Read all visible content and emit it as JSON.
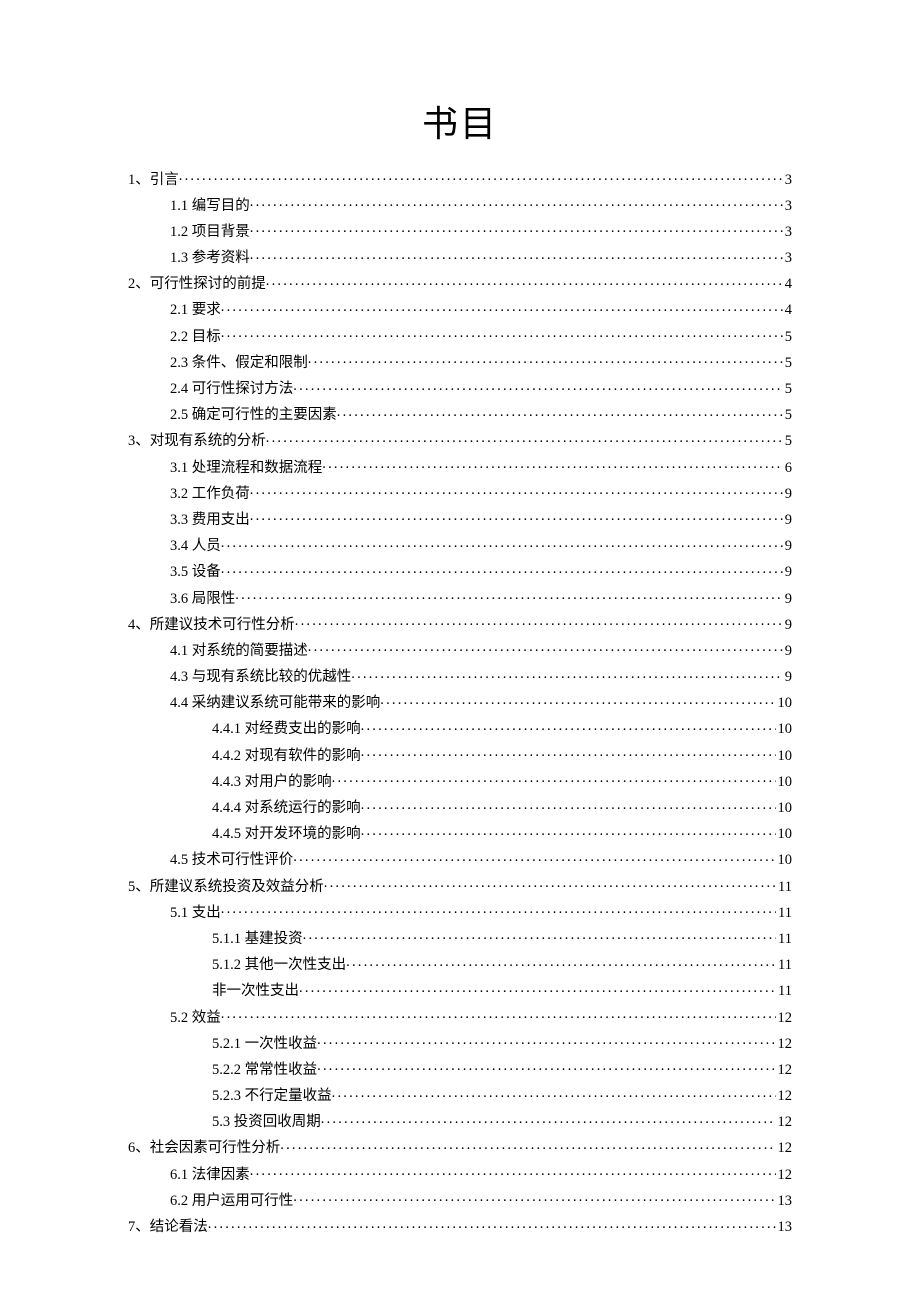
{
  "title": "书目",
  "toc": [
    {
      "level": 1,
      "label": "1、引言",
      "page": "3"
    },
    {
      "level": 2,
      "label": "1.1 编写目的",
      "page": "3"
    },
    {
      "level": 2,
      "label": "1.2 项目背景",
      "page": "3"
    },
    {
      "level": 2,
      "label": "1.3 参考资料",
      "page": "3"
    },
    {
      "level": 1,
      "label": "2、可行性探讨的前提",
      "page": "4"
    },
    {
      "level": 2,
      "label": "2.1 要求",
      "page": "4"
    },
    {
      "level": 2,
      "label": "2.2 目标",
      "page": "5"
    },
    {
      "level": 2,
      "label": "2.3 条件、假定和限制",
      "page": "5"
    },
    {
      "level": 2,
      "label": "2.4 可行性探讨方法",
      "page": "5"
    },
    {
      "level": 2,
      "label": "2.5 确定可行性的主要因素",
      "page": "5"
    },
    {
      "level": 1,
      "label": "3、对现有系统的分析",
      "page": "5"
    },
    {
      "level": 2,
      "label": "3.1 处理流程和数据流程",
      "page": "6"
    },
    {
      "level": 2,
      "label": "3.2 工作负荷",
      "page": "9"
    },
    {
      "level": 2,
      "label": "3.3 费用支出",
      "page": "9"
    },
    {
      "level": 2,
      "label": "3.4 人员",
      "page": "9"
    },
    {
      "level": 2,
      "label": "3.5 设备",
      "page": "9"
    },
    {
      "level": 2,
      "label": "3.6 局限性",
      "page": "9"
    },
    {
      "level": 1,
      "label": "4、所建议技术可行性分析",
      "page": "9"
    },
    {
      "level": 2,
      "label": "4.1 对系统的简要描述",
      "page": "9"
    },
    {
      "level": 2,
      "label": "4.3 与现有系统比较的优越性",
      "page": "9"
    },
    {
      "level": 2,
      "label": "4.4 采纳建议系统可能带来的影响",
      "page": "10"
    },
    {
      "level": 3,
      "label": "4.4.1 对经费支出的影响",
      "page": "10"
    },
    {
      "level": 3,
      "label": "4.4.2 对现有软件的影响",
      "page": "10"
    },
    {
      "level": 3,
      "label": "4.4.3 对用户的影响",
      "page": "10"
    },
    {
      "level": 3,
      "label": "4.4.4 对系统运行的影响",
      "page": "10"
    },
    {
      "level": 3,
      "label": "4.4.5 对开发环境的影响",
      "page": "10"
    },
    {
      "level": 2,
      "label": "4.5 技术可行性评价 ",
      "page": "10"
    },
    {
      "level": 1,
      "label": "5、所建议系统投资及效益分析",
      "page": "11"
    },
    {
      "level": 2,
      "label": "5.1 支出",
      "page": "11"
    },
    {
      "level": 3,
      "label": "5.1.1 基建投资",
      "page": "11"
    },
    {
      "level": 3,
      "label": "5.1.2 其他一次性支出",
      "page": "11"
    },
    {
      "level": 3,
      "label": "非一次性支出",
      "page": "11"
    },
    {
      "level": 2,
      "label": "5.2 效益",
      "page": "12"
    },
    {
      "level": 3,
      "label": "5.2.1 一次性收益",
      "page": "12"
    },
    {
      "level": 3,
      "label": "5.2.2 常常性收益",
      "page": "12"
    },
    {
      "level": 3,
      "label": "5.2.3 不行定量收益",
      "page": "12"
    },
    {
      "level": 3,
      "label": "5.3 投资回收周期 ",
      "page": "12"
    },
    {
      "level": 1,
      "label": "6、社会因素可行性分析",
      "page": "12"
    },
    {
      "level": 2,
      "label": "6.1 法律因素",
      "page": "12"
    },
    {
      "level": 2,
      "label": "6.2 用户运用可行性",
      "page": "13"
    },
    {
      "level": 1,
      "label": "7、结论看法",
      "page": "13"
    }
  ]
}
